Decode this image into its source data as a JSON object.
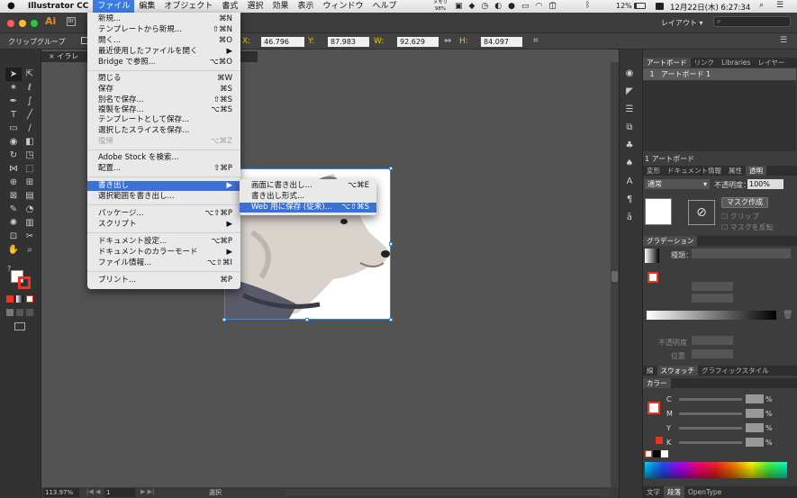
{
  "menubar": {
    "app_name": "Illustrator CC",
    "items": [
      "ファイル",
      "編集",
      "オブジェクト",
      "書式",
      "選択",
      "効果",
      "表示",
      "ウィンドウ",
      "ヘルプ"
    ],
    "memory": "メモリ",
    "memory_pct": "98%",
    "battery": "12%",
    "clock": "12月22日(木) 6:27:34"
  },
  "appbar": {
    "logo": "Ai",
    "workspace": "レイアウト",
    "search_placeholder": ""
  },
  "control": {
    "group_label": "クリップグループ",
    "x_label": "X:",
    "x_value": "46.796 mm",
    "y_label": "Y:",
    "y_value": "87.983 mm",
    "w_label": "W:",
    "w_value": "92.629 mm",
    "h_label": "H:",
    "h_value": "84.097 mm"
  },
  "document": {
    "tab_title": "イラレ"
  },
  "status": {
    "zoom": "113.97%",
    "page": "1",
    "mode": "選択"
  },
  "file_menu": {
    "items": [
      {
        "label": "新規...",
        "shortcut": "⌘N"
      },
      {
        "label": "テンプレートから新規...",
        "shortcut": "⇧⌘N"
      },
      {
        "label": "開く...",
        "shortcut": "⌘O"
      },
      {
        "label": "最近使用したファイルを開く",
        "shortcut": "▶"
      },
      {
        "label": "Bridge で参照...",
        "shortcut": "⌥⌘O"
      },
      {
        "label": "閉じる",
        "shortcut": "⌘W"
      },
      {
        "label": "保存",
        "shortcut": "⌘S"
      },
      {
        "label": "別名で保存...",
        "shortcut": "⇧⌘S"
      },
      {
        "label": "複製を保存...",
        "shortcut": "⌥⌘S"
      },
      {
        "label": "テンプレートとして保存...",
        "shortcut": ""
      },
      {
        "label": "選択したスライスを保存...",
        "shortcut": ""
      },
      {
        "label": "復帰",
        "shortcut": "⌥⌘Z"
      },
      {
        "label": "Adobe Stock を検索...",
        "shortcut": ""
      },
      {
        "label": "配置...",
        "shortcut": "⇧⌘P"
      },
      {
        "label": "書き出し",
        "shortcut": "▶"
      },
      {
        "label": "選択範囲を書き出し...",
        "shortcut": ""
      },
      {
        "label": "パッケージ...",
        "shortcut": "⌥⇧⌘P"
      },
      {
        "label": "スクリプト",
        "shortcut": "▶"
      },
      {
        "label": "ドキュメント設定...",
        "shortcut": "⌥⌘P"
      },
      {
        "label": "ドキュメントのカラーモード",
        "shortcut": "▶"
      },
      {
        "label": "ファイル情報...",
        "shortcut": "⌥⇧⌘I"
      },
      {
        "label": "プリント...",
        "shortcut": "⌘P"
      }
    ]
  },
  "export_submenu": {
    "items": [
      {
        "label": "画面に書き出し...",
        "shortcut": "⌥⌘E"
      },
      {
        "label": "書き出し形式...",
        "shortcut": ""
      },
      {
        "label": "Web 用に保存 (従来)...",
        "shortcut": "⌥⇧⌘S"
      }
    ]
  },
  "panels": {
    "artboard_tabs": [
      "アートボード",
      "リンク",
      "Libraries",
      "レイヤー"
    ],
    "artboard_row_num": "1",
    "artboard_row_name": "アートボード 1",
    "artboard_count": "1 アートボード",
    "transparency_tabs": [
      "変形",
      "ドキュメント情報",
      "属性",
      "透明"
    ],
    "blend_mode": "通常",
    "opacity_label": "不透明度：",
    "opacity_value": "100%",
    "make_mask": "マスク作成",
    "clip": "クリップ",
    "invert_mask": "マスクを反転",
    "gradient_tab": "グラデーション",
    "gradient_type": "種類：",
    "gradient_opacity": "不透明度",
    "gradient_position": "位置",
    "swatch_tabs": [
      "線",
      "スウォッチ",
      "グラフィックスタイル"
    ],
    "color_tab": "カラー",
    "cmyk": [
      "C",
      "M",
      "Y",
      "K"
    ],
    "pct": "%",
    "type_tabs": [
      "文字",
      "段落",
      "OpenType"
    ]
  }
}
